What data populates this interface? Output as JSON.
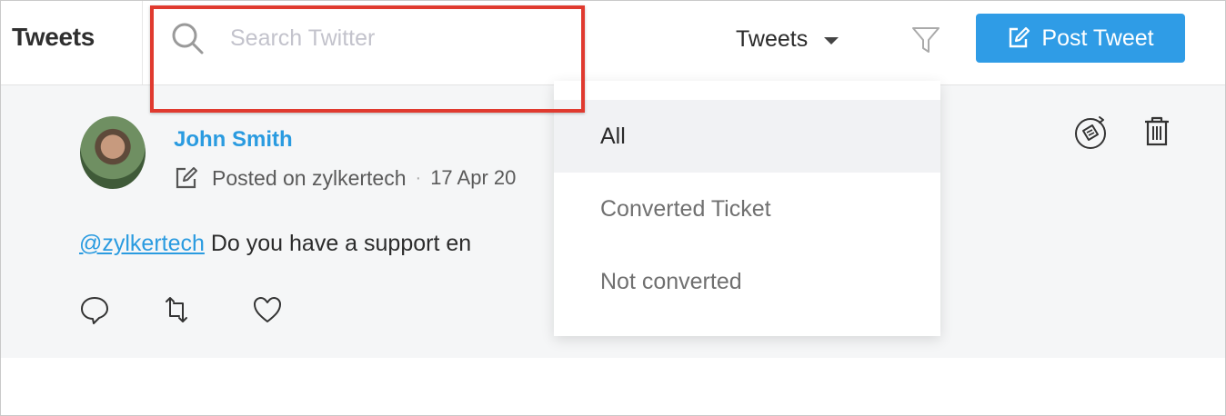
{
  "header": {
    "title": "Tweets",
    "search": {
      "placeholder": "Search Twitter",
      "value": ""
    },
    "filter_dropdown": {
      "selected": "Tweets"
    },
    "post_button_label": "Post Tweet"
  },
  "filter_menu": {
    "items": [
      {
        "label": "All",
        "active": true
      },
      {
        "label": "Converted Ticket",
        "active": false
      },
      {
        "label": "Not converted",
        "active": false
      }
    ]
  },
  "tweet": {
    "author": "John Smith",
    "source": "Posted on zylkertech",
    "separator": "·",
    "date": "17 Apr 20",
    "mention": "@zylkertech",
    "text": " Do you have a support en"
  },
  "icons": {
    "search": "search-icon",
    "filter": "funnel-icon",
    "compose": "compose-icon",
    "reply": "reply-icon",
    "retweet": "retweet-icon",
    "like": "heart-icon",
    "convert": "convert-to-ticket-icon",
    "delete": "trash-icon"
  },
  "colors": {
    "accent": "#2f9ce6",
    "link": "#2a9be0",
    "highlight": "#e03a2f",
    "content_bg": "#f5f6f7"
  }
}
